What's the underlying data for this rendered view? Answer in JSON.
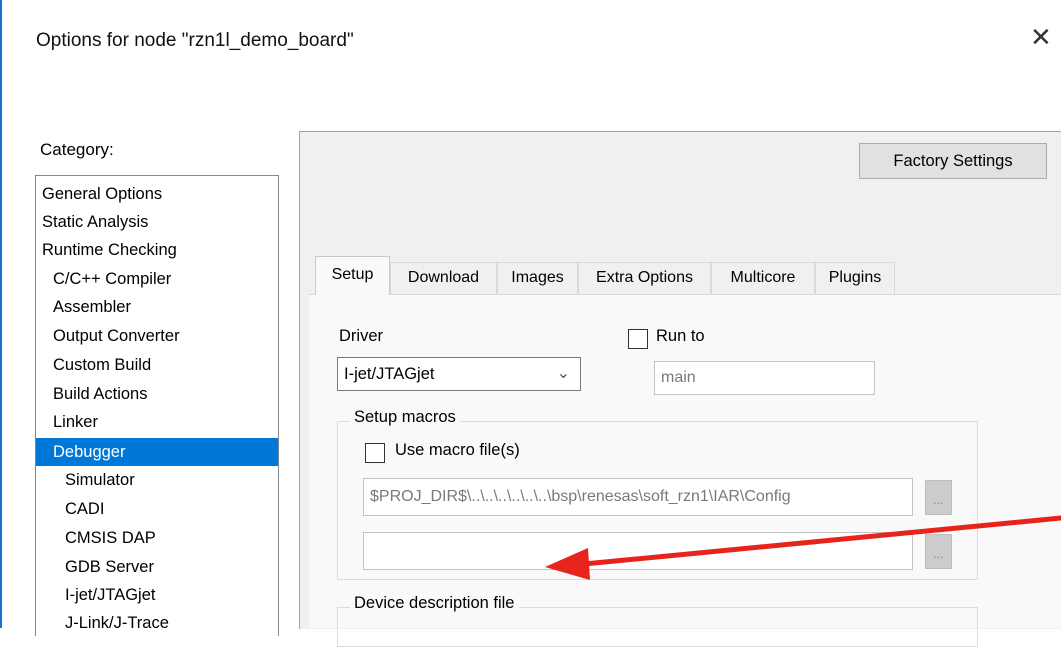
{
  "window": {
    "title": "Options for node \"rzn1l_demo_board\"",
    "close_glyph": "✕",
    "accent": "#0078d7"
  },
  "category": {
    "label": "Category:",
    "items": [
      {
        "label": "General Options",
        "indent": 0
      },
      {
        "label": "Static Analysis",
        "indent": 0
      },
      {
        "label": "Runtime Checking",
        "indent": 0
      },
      {
        "label": "C/C++ Compiler",
        "indent": 1
      },
      {
        "label": "Assembler",
        "indent": 1
      },
      {
        "label": "Output Converter",
        "indent": 1
      },
      {
        "label": "Custom Build",
        "indent": 1
      },
      {
        "label": "Build Actions",
        "indent": 1
      },
      {
        "label": "Linker",
        "indent": 1
      },
      {
        "label": "Debugger",
        "indent": 1,
        "selected": true
      },
      {
        "label": "Simulator",
        "indent": 2
      },
      {
        "label": "CADI",
        "indent": 2
      },
      {
        "label": "CMSIS DAP",
        "indent": 2
      },
      {
        "label": "GDB Server",
        "indent": 2
      },
      {
        "label": "I-jet/JTAGjet",
        "indent": 2
      },
      {
        "label": "J-Link/J-Trace",
        "indent": 2
      }
    ]
  },
  "factory_settings_label": "Factory Settings",
  "tabs": [
    {
      "label": "Setup",
      "active": true
    },
    {
      "label": "Download"
    },
    {
      "label": "Images"
    },
    {
      "label": "Extra Options"
    },
    {
      "label": "Multicore"
    },
    {
      "label": "Plugins"
    }
  ],
  "setup": {
    "driver_label": "Driver",
    "driver_value": "I-jet/JTAGjet",
    "run_to_label": "Run to",
    "run_to_checked": false,
    "run_to_value": "main",
    "setup_macros_title": "Setup macros",
    "use_macro_label": "Use macro file(s)",
    "use_macro_checked": false,
    "macro_path": "$PROJ_DIR$\\..\\..\\..\\..\\..\\..\\bsp\\renesas\\soft_rzn1\\IAR\\Config",
    "macro_path2": "",
    "ellipsis_label": "...",
    "device_file_title": "Device description file"
  },
  "annotation": {
    "arrow_color": "#e8231c"
  }
}
